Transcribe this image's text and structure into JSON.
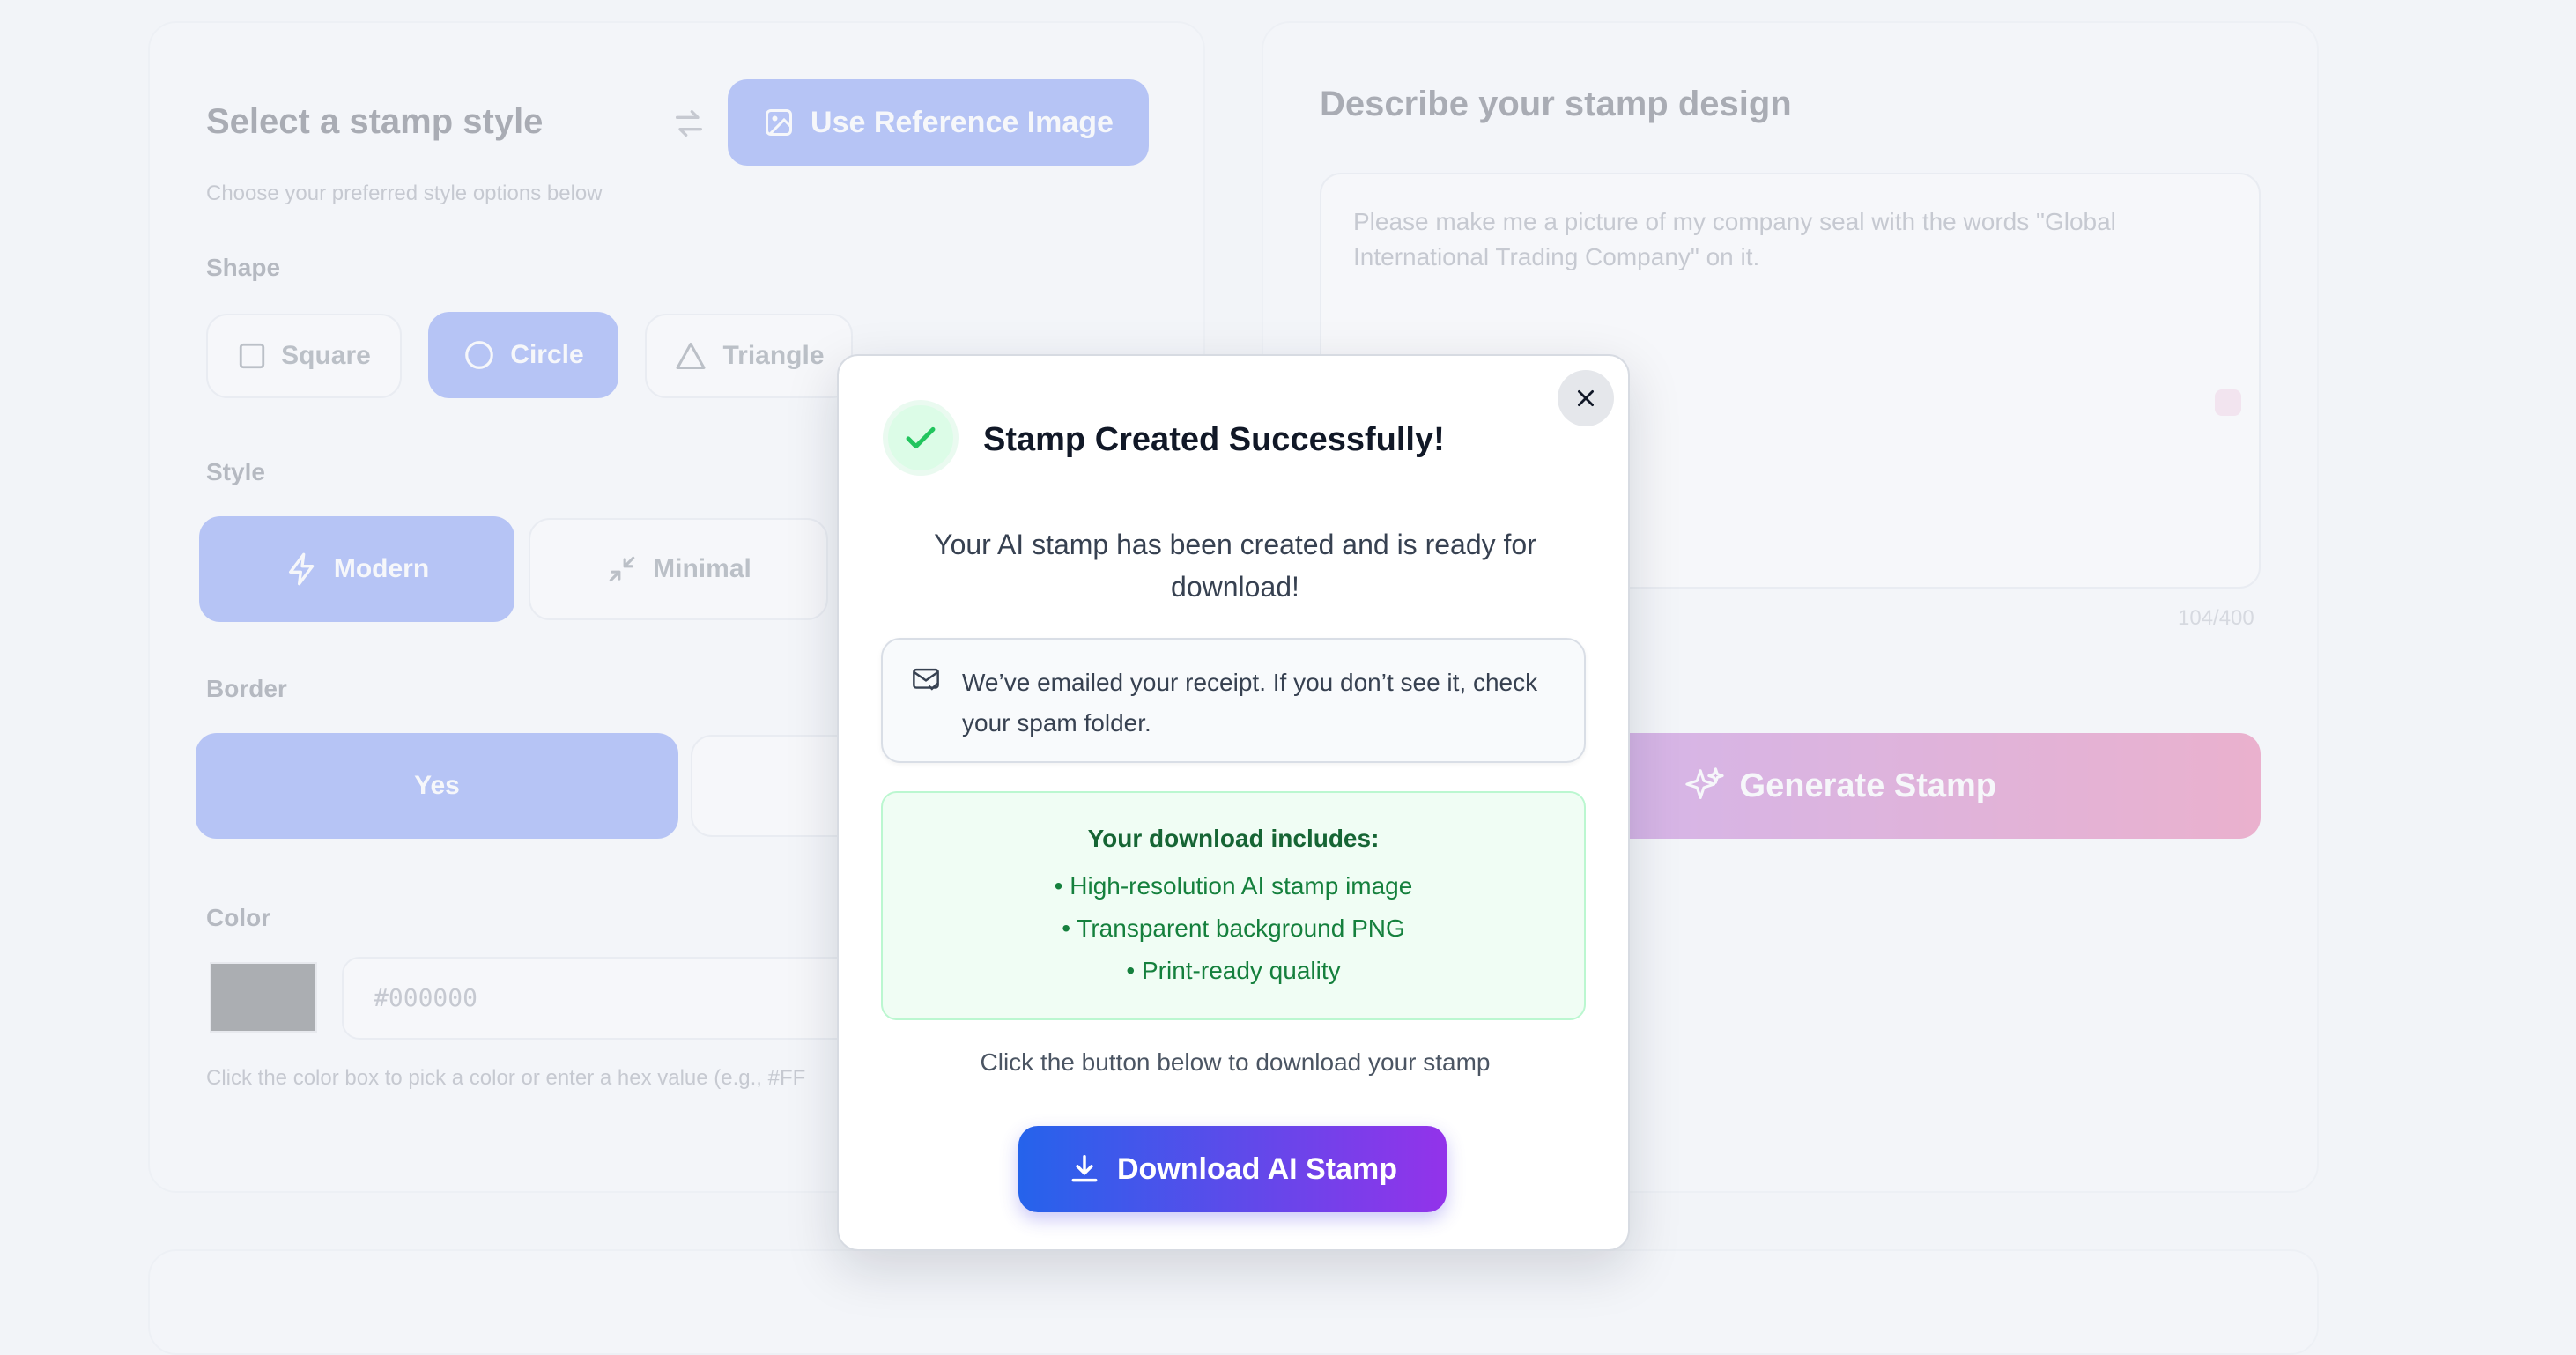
{
  "left_panel": {
    "title": "Select a stamp style",
    "reference_button": "Use Reference Image",
    "subtitle": "Choose your preferred style options below",
    "shape_label": "Shape",
    "shapes": [
      "Square",
      "Circle",
      "Triangle"
    ],
    "selected_shape": "Circle",
    "style_label": "Style",
    "styles": [
      "Modern",
      "Minimal"
    ],
    "selected_style": "Modern",
    "border_label": "Border",
    "border_yes": "Yes",
    "color_label": "Color",
    "color_value": "#000000",
    "color_hint": "Click the color box to pick a color or enter a hex value (e.g., #FF"
  },
  "right_panel": {
    "title": "Describe your stamp design",
    "prompt_text": "Please make me a picture of my company seal with the words \"Global International Trading Company\" on it.",
    "char_count": "104/400",
    "generate_button": "Generate Stamp"
  },
  "modal": {
    "title": "Stamp Created Successfully!",
    "message": "Your AI stamp has been created and is ready for download!",
    "notice": "We’ve emailed your receipt. If you don’t see it, check your spam folder.",
    "includes_title": "Your download includes:",
    "includes": [
      "High-resolution AI stamp image",
      "Transparent background PNG",
      "Print-ready quality"
    ],
    "hint": "Click the button below to download your stamp",
    "download_button": "Download AI Stamp"
  },
  "colors": {
    "primary_blue": "#2563eb",
    "primary_purple": "#9333ea",
    "success_green": "#22c55e"
  }
}
